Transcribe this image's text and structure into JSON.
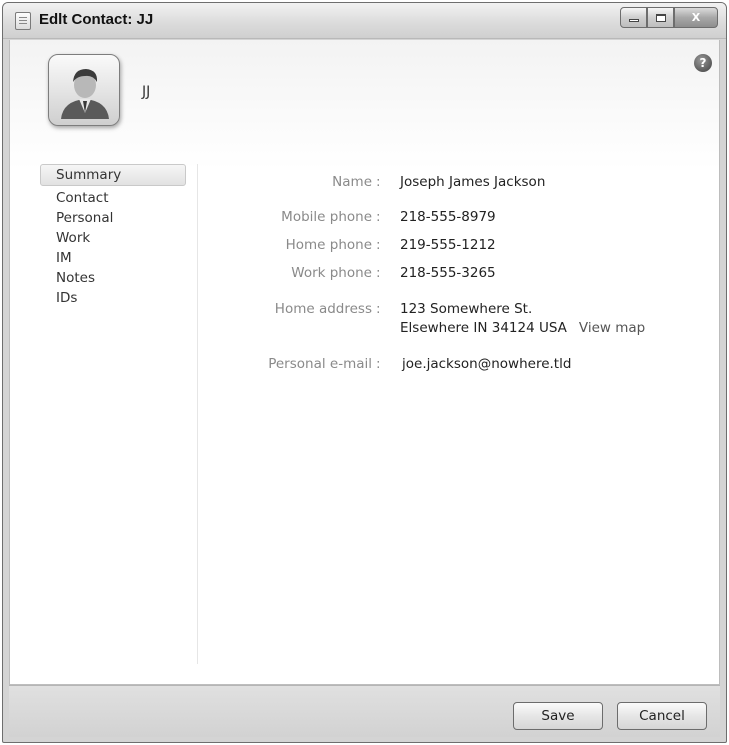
{
  "window": {
    "title": "Edlt Contact: JJ",
    "close_glyph": "X"
  },
  "header": {
    "nickname": "JJ",
    "help_glyph": "?"
  },
  "nav": {
    "items": [
      {
        "label": "Summary"
      },
      {
        "label": "Contact"
      },
      {
        "label": "Personal"
      },
      {
        "label": "Work"
      },
      {
        "label": "IM"
      },
      {
        "label": "Notes"
      },
      {
        "label": "IDs"
      }
    ],
    "selected": "Summary"
  },
  "summary": {
    "colon": ":",
    "name": {
      "label": "Name",
      "value": "Joseph James Jackson"
    },
    "mobile": {
      "label": "Mobile phone",
      "value": "218-555-8979"
    },
    "home_phone": {
      "label": "Home phone",
      "value": "219-555-1212"
    },
    "work_phone": {
      "label": "Work phone",
      "value": "218-555-3265"
    },
    "home_address": {
      "label": "Home address",
      "line1": "123 Somewhere St.",
      "line2": "Elsewhere IN 34124 USA",
      "map_link": "View map"
    },
    "email": {
      "label": "Personal e-mail",
      "value": "joe.jackson@nowhere.tld"
    }
  },
  "footer": {
    "save_label": "Save",
    "cancel_label": "Cancel"
  },
  "icons": [
    "window-icon",
    "minimize-icon",
    "maximize-icon",
    "close-icon",
    "help-icon",
    "avatar-icon"
  ]
}
